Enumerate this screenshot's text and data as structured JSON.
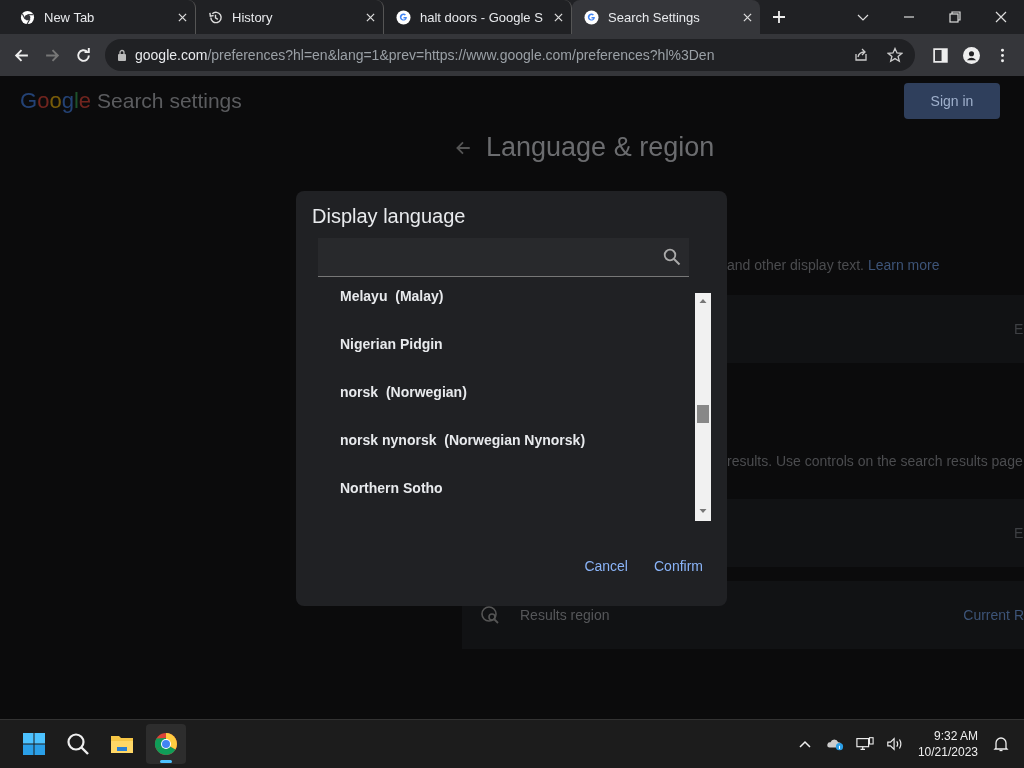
{
  "tabs": [
    {
      "title": "New Tab",
      "kind": "chrome",
      "selected": false
    },
    {
      "title": "History",
      "kind": "history",
      "selected": false
    },
    {
      "title": "halt doors - Google S",
      "kind": "google",
      "selected": false
    },
    {
      "title": "Search Settings",
      "kind": "google",
      "selected": true
    }
  ],
  "address": {
    "domain": "google.com",
    "path": "/preferences?hl=en&lang=1&prev=https://www.google.com/preferences?hl%3Den"
  },
  "page": {
    "logo": "Google",
    "title": "Search settings",
    "sign_in": "Sign in",
    "heading": "Language & region",
    "line_1": "and other display text.",
    "learn_more": "Learn more",
    "card_1_value": "E",
    "line_2": "results. Use controls on the search results page",
    "card_2_value": "E",
    "results_region": "Results region",
    "results_region_value": "Current R"
  },
  "dialog": {
    "title": "Display language",
    "items": [
      "Melayu  (Malay)",
      "Nigerian Pidgin",
      "norsk  (Norwegian)",
      "norsk nynorsk  (Norwegian Nynorsk)",
      "Northern Sotho"
    ],
    "cancel": "Cancel",
    "confirm": "Confirm"
  },
  "taskbar": {
    "apps": [
      {
        "kind": "start",
        "selected": false
      },
      {
        "kind": "search",
        "selected": false
      },
      {
        "kind": "files",
        "selected": false
      },
      {
        "kind": "chrome",
        "selected": true
      }
    ],
    "time": "9:32 AM",
    "date": "10/21/2023"
  }
}
